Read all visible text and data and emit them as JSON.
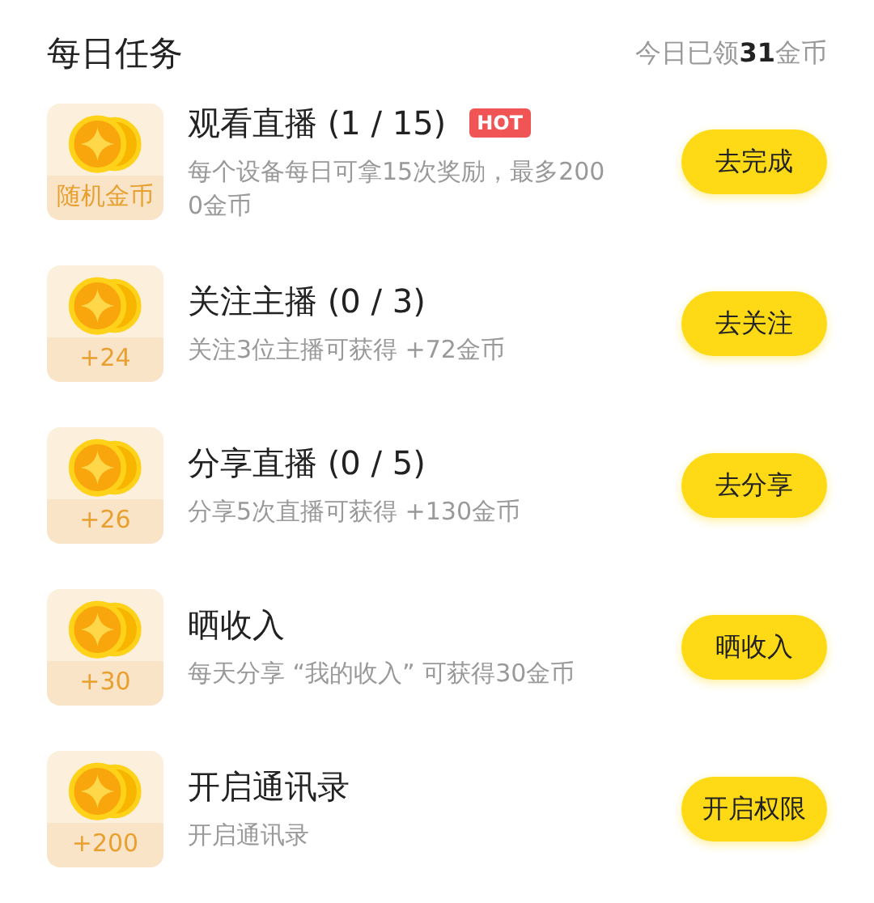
{
  "header": {
    "title": "每日任务",
    "summary": "今日已领**31**金币"
  },
  "tasks": [
    {
      "reward": "随机金币",
      "title": "观看直播 (1 / 15)",
      "badge": "HOT",
      "description": "每个设备每日可拿15次奖励，最多2000金币",
      "button": "去完成"
    },
    {
      "reward": "+24",
      "title": "关注主播 (0 / 3)",
      "description": "关注3位主播可获得 +72金币",
      "button": "去关注"
    },
    {
      "reward": "+26",
      "title": "分享直播 (0 / 5)",
      "description": "分享5次直播可获得 +130金币",
      "button": "去分享"
    },
    {
      "reward": "+30",
      "title": "晒收入",
      "description": "每天分享 “我的收入” 可获得30金币",
      "button": "晒收入"
    },
    {
      "reward": "+200",
      "title": "开启通讯录",
      "description": "开启通讯录",
      "button": "开启权限"
    }
  ]
}
